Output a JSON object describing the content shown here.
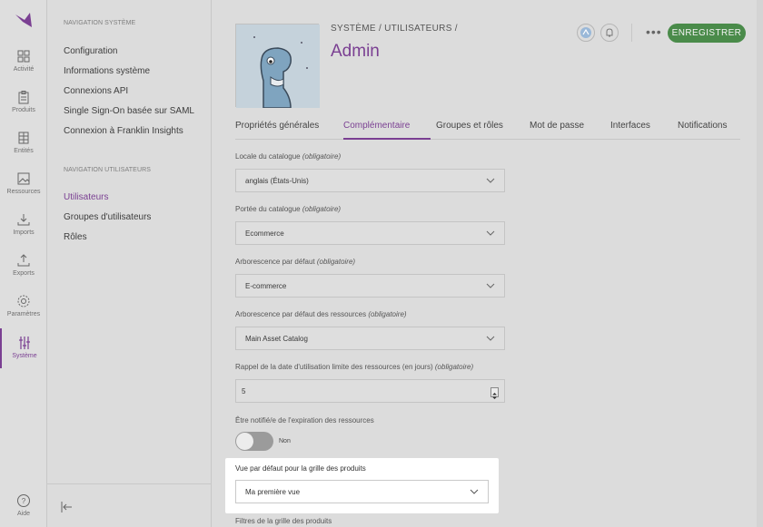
{
  "rail": {
    "items": [
      {
        "label": "Activité",
        "icon": "grid-icon"
      },
      {
        "label": "Produits",
        "icon": "clipboard-icon"
      },
      {
        "label": "Entités",
        "icon": "table-icon"
      },
      {
        "label": "Ressources",
        "icon": "image-icon"
      },
      {
        "label": "Imports",
        "icon": "download-icon"
      },
      {
        "label": "Exports",
        "icon": "upload-icon"
      },
      {
        "label": "Paramètres",
        "icon": "gear-icon"
      },
      {
        "label": "Système",
        "icon": "sliders-icon"
      }
    ],
    "help_label": "Aide",
    "accent": "#7a3f92"
  },
  "subnav": {
    "system_title": "NAVIGATION SYSTÈME",
    "system_links": [
      "Configuration",
      "Informations système",
      "Connexions API",
      "Single Sign-On basée sur SAML",
      "Connexion à Franklin Insights"
    ],
    "users_title": "NAVIGATION UTILISATEURS",
    "users_links": [
      "Utilisateurs",
      "Groupes d'utilisateurs",
      "Rôles"
    ]
  },
  "header": {
    "breadcrumb": "SYSTÈME / UTILISATEURS /",
    "title": "Admin",
    "save_label": "ENREGISTRER",
    "save_color": "#4a8b4a"
  },
  "tabs": [
    "Propriétés générales",
    "Complémentaire",
    "Groupes et rôles",
    "Mot de passe",
    "Interfaces",
    "Notifications"
  ],
  "fields": {
    "locale_label": "Locale du catalogue",
    "locale_value": "anglais (États-Unis)",
    "scope_label": "Portée du catalogue",
    "scope_value": "Ecommerce",
    "tree_label": "Arborescence par défaut",
    "tree_value": "E-commerce",
    "asset_tree_label": "Arborescence par défaut des ressources",
    "asset_tree_value": "Main Asset Catalog",
    "reminder_label": "Rappel de la date d'utilisation limite des ressources (en jours)",
    "reminder_value": "5",
    "notify_label": "Être notifié/e de l'expiration des ressources",
    "notify_state": "Non",
    "grid_view_label": "Vue par défaut pour la grille des produits",
    "grid_view_value": "Ma première vue",
    "grid_filters_label": "Filtres de la grille des produits",
    "required": "(obligatoire)"
  }
}
